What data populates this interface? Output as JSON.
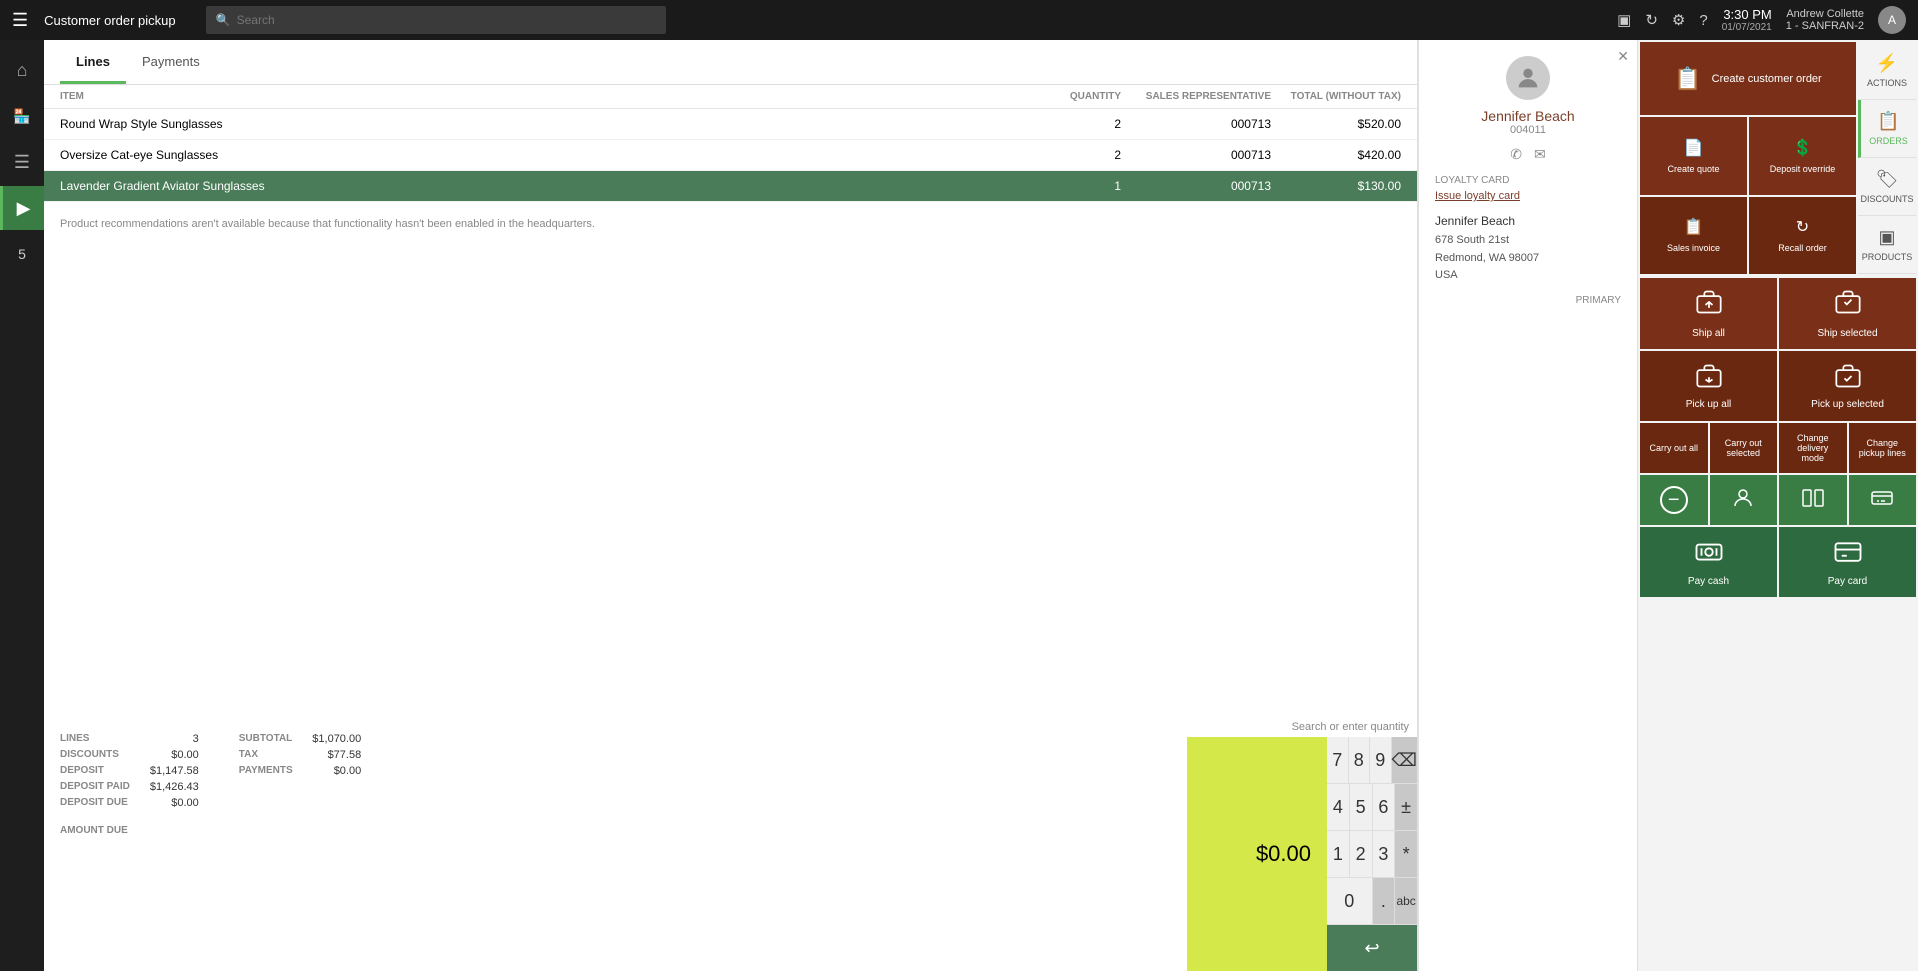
{
  "topbar": {
    "menu_icon": "≡",
    "title": "Customer order pickup",
    "search_placeholder": "Search",
    "time": "3:30 PM",
    "date": "01/07/2021",
    "user_name": "Andrew Collette",
    "user_store": "1 - SANFRAN-2"
  },
  "sidebar": {
    "items": [
      {
        "id": "home",
        "icon": "⌂",
        "active": false
      },
      {
        "id": "store",
        "icon": "🏪",
        "active": false
      },
      {
        "id": "menu",
        "icon": "☰",
        "active": false
      },
      {
        "id": "pos",
        "icon": "🖥",
        "active": true
      },
      {
        "id": "badge",
        "icon": "5",
        "active": false,
        "badge": "5"
      }
    ]
  },
  "tabs": [
    {
      "label": "Lines",
      "active": true
    },
    {
      "label": "Payments",
      "active": false
    }
  ],
  "table": {
    "headers": [
      "ITEM",
      "QUANTITY",
      "SALES REPRESENTATIVE",
      "TOTAL (WITHOUT TAX)"
    ],
    "rows": [
      {
        "item": "Round Wrap Style Sunglasses",
        "quantity": "2",
        "sales_rep": "000713",
        "total": "$520.00",
        "selected": false
      },
      {
        "item": "Oversize Cat-eye Sunglasses",
        "quantity": "2",
        "sales_rep": "000713",
        "total": "$420.00",
        "selected": false
      },
      {
        "item": "Lavender Gradient Aviator Sunglasses",
        "quantity": "1",
        "sales_rep": "000713",
        "total": "$130.00",
        "selected": true
      }
    ]
  },
  "recommendation_text": "Product recommendations aren't available because that functionality hasn't been enabled in the headquarters.",
  "numpad": {
    "qty_label": "Search or enter quantity",
    "buttons": [
      "7",
      "8",
      "9",
      "⌫",
      "4",
      "5",
      "6",
      "±",
      "1",
      "2",
      "3",
      "*",
      "0",
      ".",
      "abc"
    ]
  },
  "summary": {
    "lines_label": "LINES",
    "lines_value": "3",
    "subtotal_label": "SUBTOTAL",
    "subtotal_value": "$1,070.00",
    "discounts_label": "DISCOUNTS",
    "discounts_value": "$0.00",
    "tax_label": "TAX",
    "tax_value": "$77.58",
    "deposit_label": "DEPOSIT",
    "deposit_value": "$1,147.58",
    "payments_label": "PAYMENTS",
    "payments_value": "$0.00",
    "deposit_paid_label": "DEPOSIT PAID",
    "deposit_paid_value": "$1,426.43",
    "deposit_due_label": "DEPOSIT DUE",
    "deposit_due_value": "$0.00",
    "amount_due_label": "AMOUNT DUE",
    "amount_due_value": "$0.00"
  },
  "customer": {
    "name": "Jennifer Beach",
    "id": "004011",
    "loyalty_label": "LOYALTY CARD",
    "loyalty_action": "Issue loyalty card",
    "address_name": "Jennifer Beach",
    "address_line1": "678 South 21st",
    "address_line2": "Redmond, WA 98007",
    "address_country": "USA",
    "primary_label": "PRIMARY"
  },
  "action_buttons": {
    "create_customer_order": "Create customer order",
    "create_quote": "Create quote",
    "deposit_override": "Deposit override",
    "sales_invoice": "Sales invoice",
    "recall_order": "Recall order",
    "ship_all": "Ship all",
    "ship_selected": "Ship selected",
    "pick_up_all": "Pick up all",
    "pick_up_selected": "Pick up selected",
    "carry_out_all": "Carry out all",
    "carry_out_selected": "Carry out selected",
    "change_delivery_mode": "Change delivery mode",
    "change_pickup_lines": "Change pickup lines",
    "pay_cash": "Pay cash",
    "pay_card": "Pay card"
  },
  "side_buttons": {
    "actions_label": "ACTIONS",
    "orders_label": "ORDERS",
    "discounts_label": "DISCOUNTS",
    "products_label": "PRODUCTS"
  }
}
